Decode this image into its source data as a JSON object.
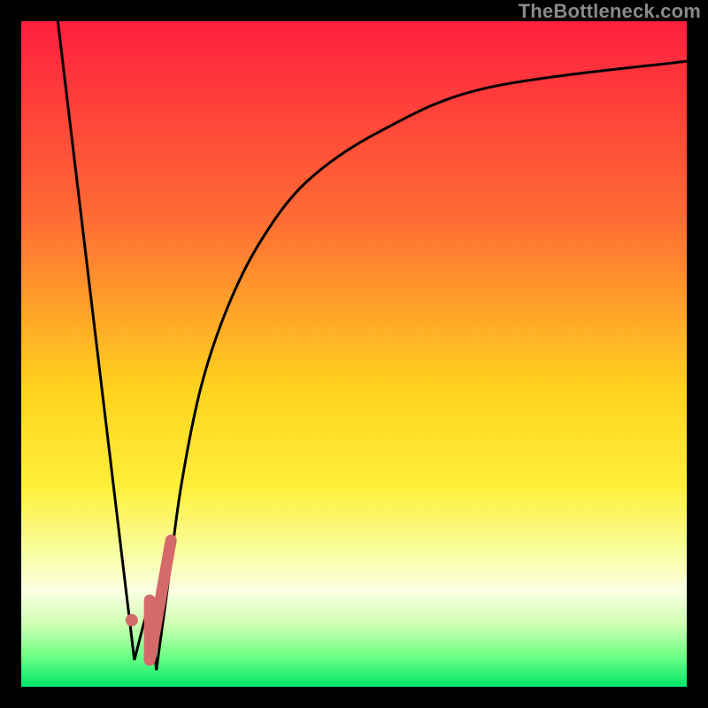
{
  "watermark": "TheBottleneck.com",
  "chart_data": {
    "type": "line",
    "title": "",
    "xlabel": "",
    "ylabel": "",
    "xlim": [
      0,
      100
    ],
    "ylim": [
      0,
      100
    ],
    "gradient_stops": [
      {
        "pct": 0.0,
        "color": "#ff1f3f"
      },
      {
        "pct": 0.3,
        "color": "#ff6d34"
      },
      {
        "pct": 0.55,
        "color": "#ffd21e"
      },
      {
        "pct": 0.7,
        "color": "#ffef39"
      },
      {
        "pct": 0.8,
        "color": "#f7ffa3"
      },
      {
        "pct": 0.855,
        "color": "#fcffe2"
      },
      {
        "pct": 0.905,
        "color": "#cfffb4"
      },
      {
        "pct": 0.955,
        "color": "#6dff85"
      },
      {
        "pct": 1.0,
        "color": "#00e86a"
      }
    ],
    "series": [
      {
        "name": "left-spike",
        "x": [
          5.5,
          17.0
        ],
        "y": [
          100,
          4
        ],
        "stroke": "#000000",
        "width": 3
      },
      {
        "name": "tail-dip",
        "x": [
          17.0,
          19.3,
          20.3
        ],
        "y": [
          4,
          13,
          2.5
        ],
        "stroke": "#000000",
        "width": 3
      },
      {
        "name": "rise-curve",
        "x": [
          20.3,
          22,
          24,
          27,
          31,
          36,
          43,
          54,
          70,
          100
        ],
        "y": [
          2.5,
          15,
          30,
          45,
          57,
          67,
          76,
          83.5,
          90,
          94
        ],
        "stroke": "#000000",
        "width": 3
      },
      {
        "name": "marker-hook",
        "x": [
          19.3,
          19.3,
          22.5
        ],
        "y": [
          13,
          4,
          22
        ],
        "stroke": "#d46a6a",
        "width": 13,
        "linecap": "round"
      },
      {
        "name": "marker-dot",
        "type": "point",
        "x": [
          16.6
        ],
        "y": [
          10
        ],
        "fill": "#d46a6a",
        "radius": 7
      }
    ]
  }
}
